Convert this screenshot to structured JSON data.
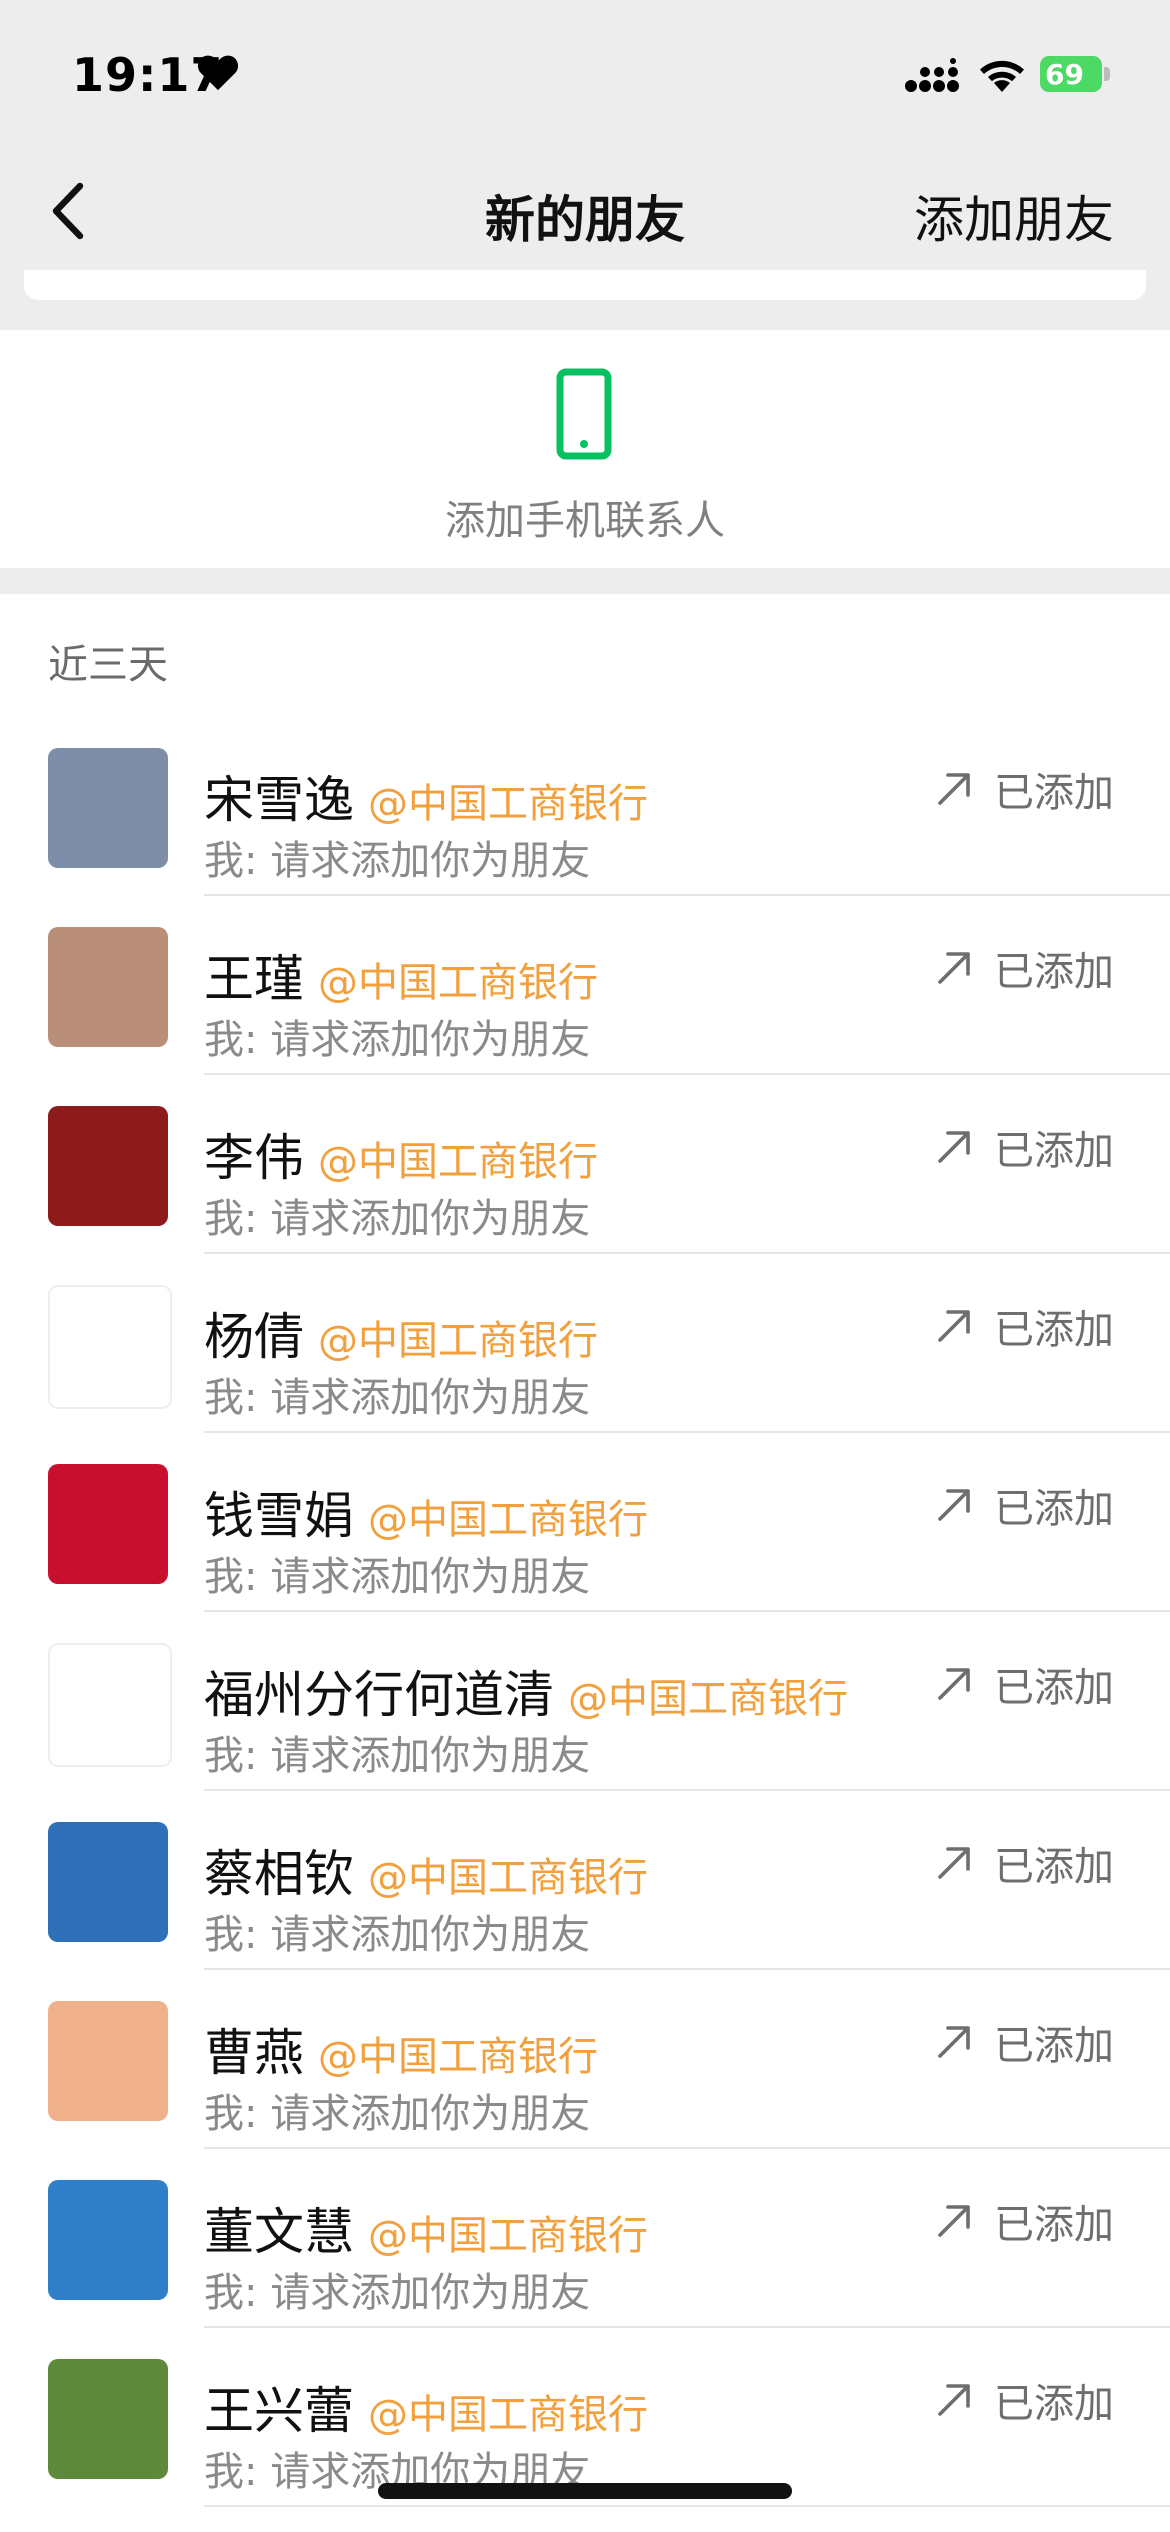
{
  "status_bar": {
    "time": "19:17",
    "battery": "69"
  },
  "nav": {
    "title": "新的朋友",
    "action": "添加朋友"
  },
  "phone_contacts": {
    "label": "添加手机联系人"
  },
  "section_header": "近三天",
  "rows": [
    {
      "name": "宋雪逸",
      "org": "@中国工商银行",
      "message": "我: 请求添加你为朋友",
      "status": "已添加",
      "avatar_color": "#7e8ea8"
    },
    {
      "name": "王瑾",
      "org": "@中国工商银行",
      "message": "我: 请求添加你为朋友",
      "status": "已添加",
      "avatar_color": "#b98f7a"
    },
    {
      "name": "李伟",
      "org": "@中国工商银行",
      "message": "我: 请求添加你为朋友",
      "status": "已添加",
      "avatar_color": "#8e1b1b"
    },
    {
      "name": "杨倩",
      "org": "@中国工商银行",
      "message": "我: 请求添加你为朋友",
      "status": "已添加",
      "avatar_color": "#ffffff"
    },
    {
      "name": "钱雪娟",
      "org": "@中国工商银行",
      "message": "我: 请求添加你为朋友",
      "status": "已添加",
      "avatar_color": "#c8102e"
    },
    {
      "name": "福州分行何道清",
      "org": "@中国工商银行",
      "message": "我: 请求添加你为朋友",
      "status": "已添加",
      "avatar_color": "#ffffff"
    },
    {
      "name": "蔡相钦",
      "org": "@中国工商银行",
      "message": "我: 请求添加你为朋友",
      "status": "已添加",
      "avatar_color": "#2f6fb8"
    },
    {
      "name": "曹燕",
      "org": "@中国工商银行",
      "message": "我: 请求添加你为朋友",
      "status": "已添加",
      "avatar_color": "#f0b08a"
    },
    {
      "name": "董文慧",
      "org": "@中国工商银行",
      "message": "我: 请求添加你为朋友",
      "status": "已添加",
      "avatar_color": "#2f7fc8"
    },
    {
      "name": "王兴蕾",
      "org": "@中国工商银行",
      "message": "我: 请求添加你为朋友",
      "status": "已添加",
      "avatar_color": "#5d8a3a"
    }
  ],
  "colors": {
    "accent_org": "#f2a03d",
    "phone_green": "#07c160",
    "battery_green": "#4cd964"
  },
  "icons": {
    "back": "chevron-left-icon",
    "phone": "mobile-phone-icon",
    "arrow": "arrow-up-right-icon",
    "heart": "heart-icon",
    "signal": "cellular-signal-icon",
    "wifi": "wifi-icon",
    "battery": "battery-icon"
  }
}
